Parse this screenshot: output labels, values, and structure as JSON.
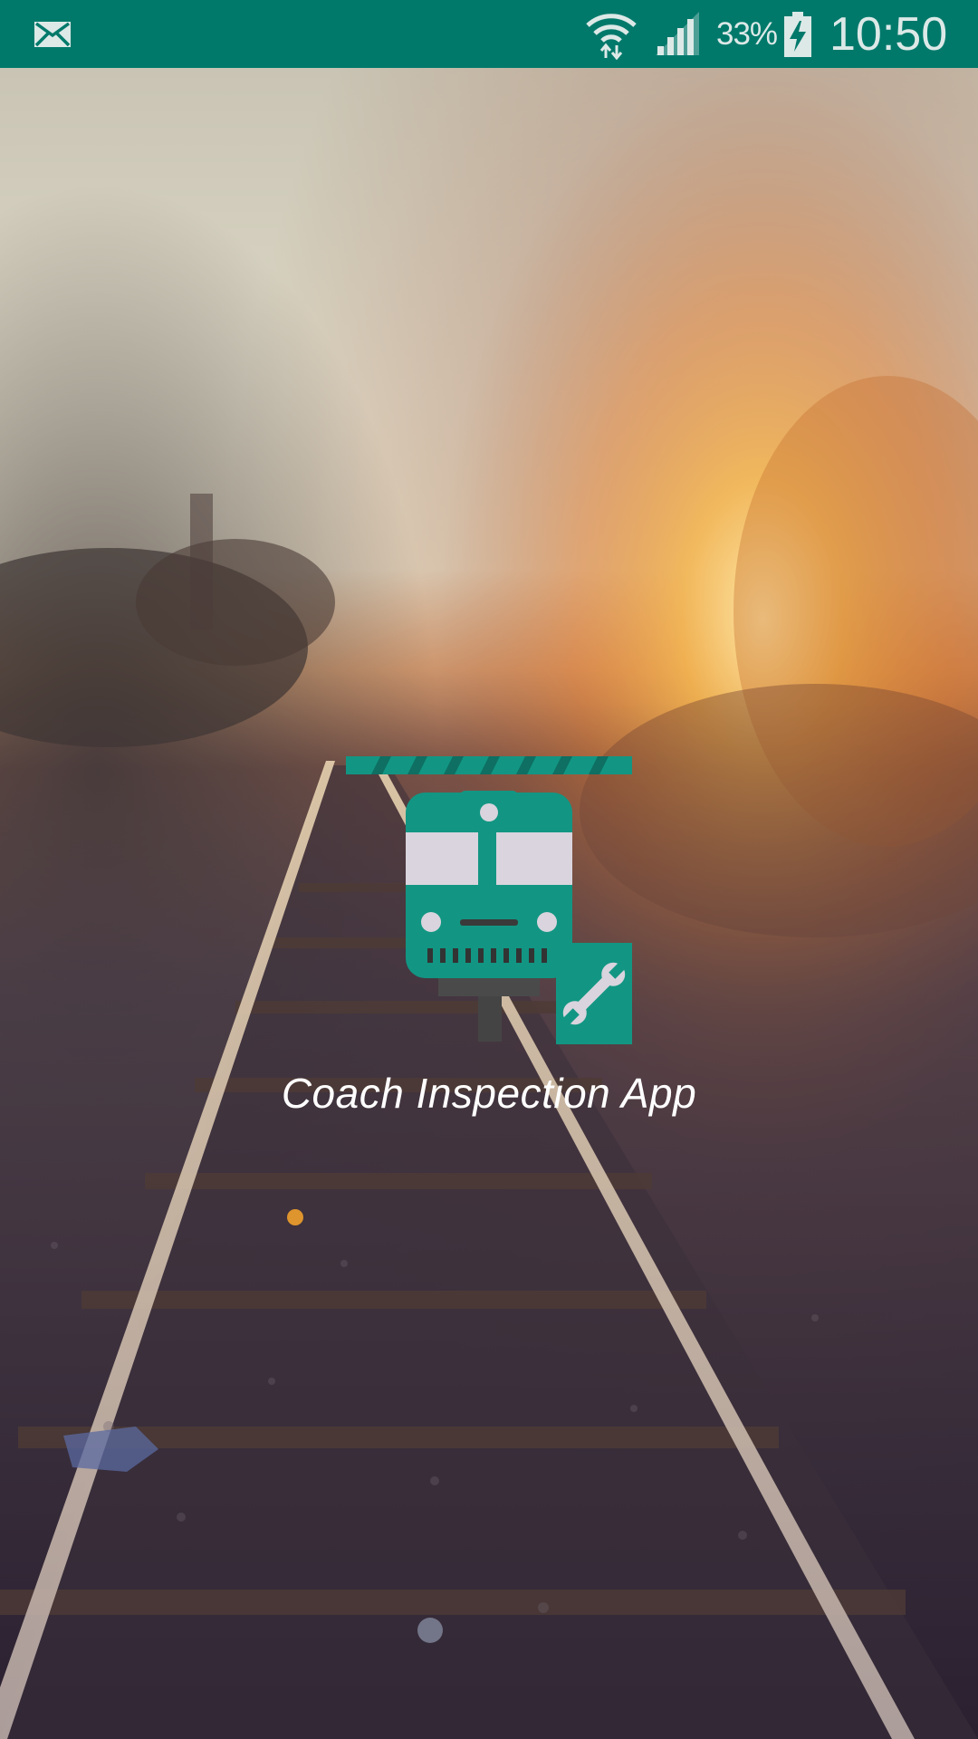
{
  "status_bar": {
    "notification_icon": "mail-icon",
    "wifi_icon": "wifi-icon",
    "signal_icon": "signal-icon",
    "battery_percent": "33%",
    "battery_icon": "battery-charging-icon",
    "time": "10:50",
    "background_color": "#00796b"
  },
  "splash": {
    "logo_icon": "train-inspection-icon",
    "title": "Coach Inspection App",
    "accent_color": "#129683"
  }
}
